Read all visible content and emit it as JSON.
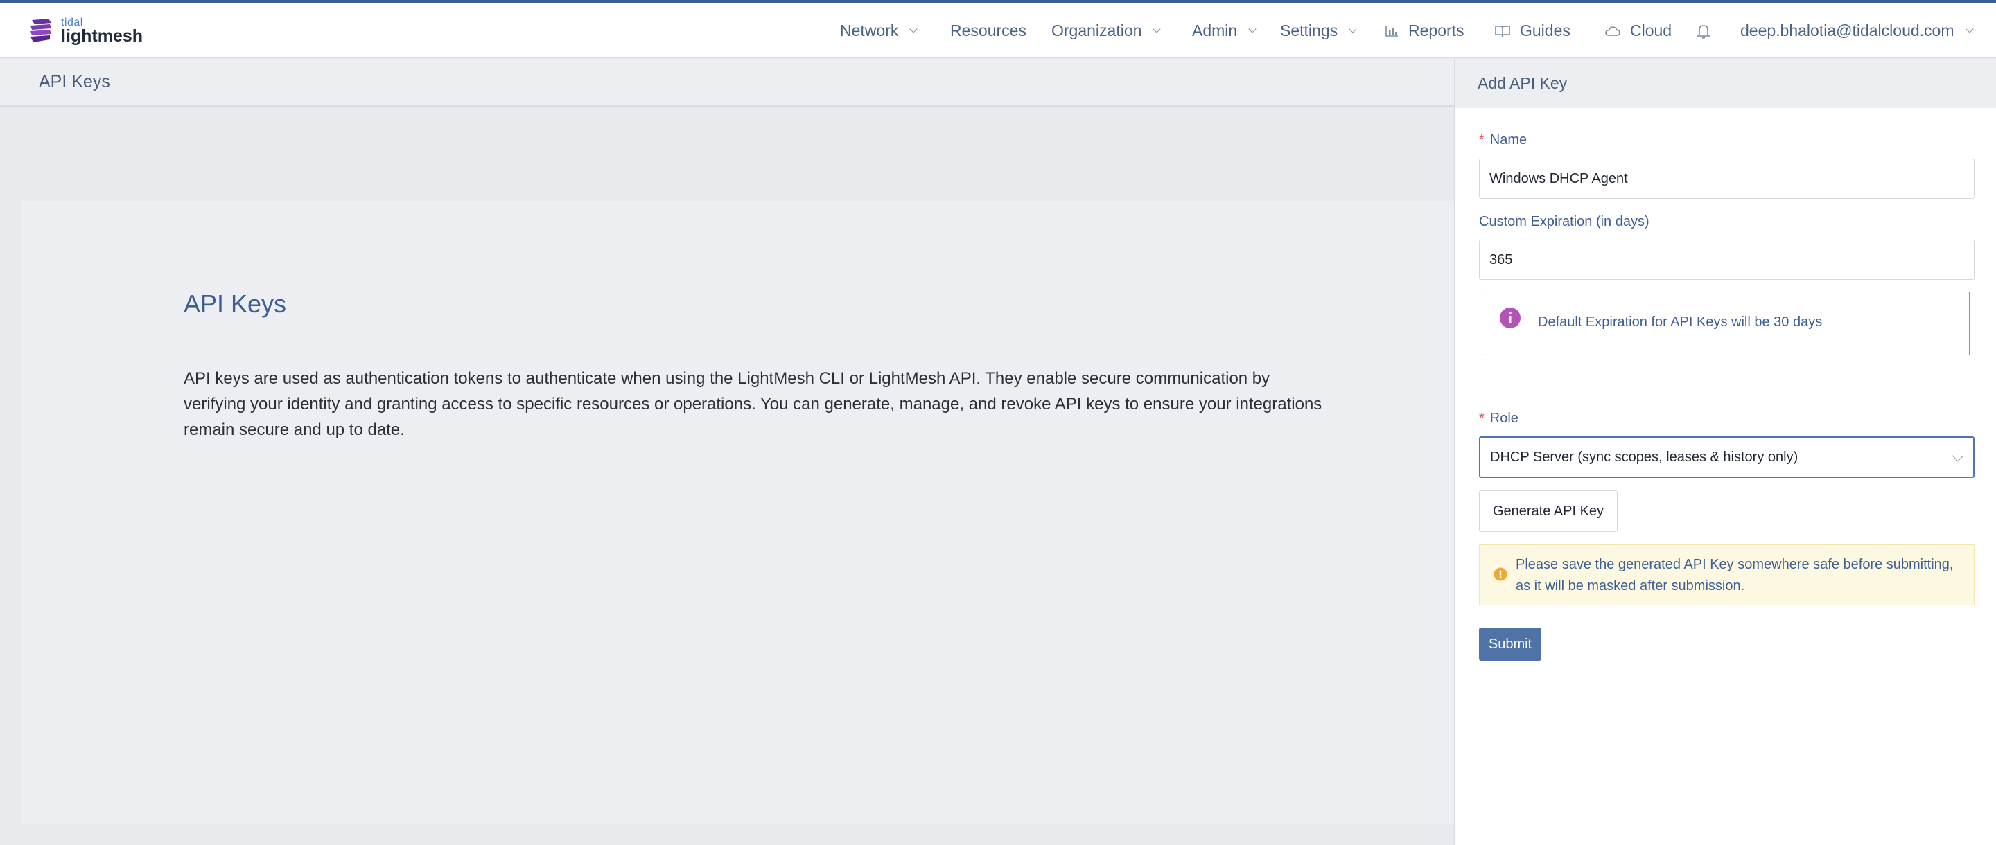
{
  "brand": {
    "top": "tidal",
    "name": "lightmesh"
  },
  "nav": {
    "network": "Network",
    "resources": "Resources",
    "organization": "Organization",
    "admin": "Admin",
    "settings": "Settings",
    "reports": "Reports",
    "guides": "Guides",
    "cloud": "Cloud",
    "user": "deep.bhalotia@tidalcloud.com"
  },
  "page": {
    "header_title": "API Keys"
  },
  "main": {
    "title": "API Keys",
    "description": "API keys are used as authentication tokens to authenticate when using the LightMesh CLI or LightMesh API. They enable secure communication by verifying your identity and granting access to specific resources or operations. You can generate, manage, and revoke API keys to ensure your integrations remain secure and up to date."
  },
  "panel": {
    "title": "Add API Key",
    "name_label": "Name",
    "name_value": "Windows DHCP Agent",
    "expiration_label": "Custom Expiration (in days)",
    "expiration_value": "365",
    "info_text": "Default Expiration for API Keys will be 30 days",
    "role_label": "Role",
    "role_value": "DHCP Server (sync scopes, leases & history only)",
    "generate_label": "Generate API Key",
    "warning_text": "Please save the generated API Key somewhere safe before submitting, as it will be masked after submission.",
    "submit_label": "Submit"
  },
  "colors": {
    "accent": "#3e5f93",
    "submit": "#4f73a7",
    "info_border": "#c86fc4",
    "warning_bg": "#fdf8e1",
    "warning_icon": "#f0a830"
  },
  "icons": [
    "lightmesh-logo",
    "chevron-down-icon",
    "bar-chart-icon",
    "book-icon",
    "cloud-icon",
    "bell-icon",
    "info-icon",
    "warning-icon"
  ]
}
